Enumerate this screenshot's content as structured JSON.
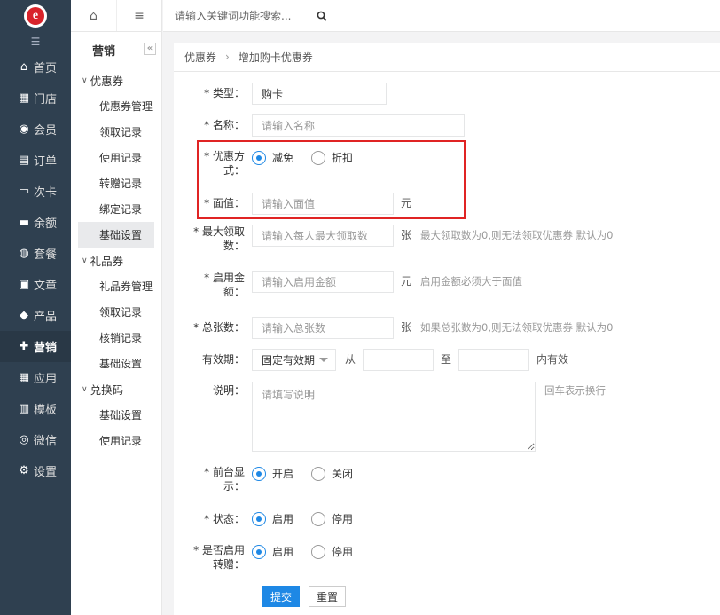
{
  "sidebar": {
    "logo_letter": "e",
    "items": [
      {
        "label": "首页",
        "icon": "home-icon",
        "glyph": "⌂"
      },
      {
        "label": "门店",
        "icon": "store-icon",
        "glyph": "▦"
      },
      {
        "label": "会员",
        "icon": "member-icon",
        "glyph": "◉"
      },
      {
        "label": "订单",
        "icon": "order-icon",
        "glyph": "▤"
      },
      {
        "label": "次卡",
        "icon": "card-icon",
        "glyph": "▭"
      },
      {
        "label": "余额",
        "icon": "balance-icon",
        "glyph": "▬"
      },
      {
        "label": "套餐",
        "icon": "package-icon",
        "glyph": "◍"
      },
      {
        "label": "文章",
        "icon": "article-icon",
        "glyph": "▣"
      },
      {
        "label": "产品",
        "icon": "product-icon",
        "glyph": "◆"
      },
      {
        "label": "营销",
        "icon": "marketing-icon",
        "glyph": "✚"
      },
      {
        "label": "应用",
        "icon": "apps-icon",
        "glyph": "▦"
      },
      {
        "label": "模板",
        "icon": "template-icon",
        "glyph": "▥"
      },
      {
        "label": "微信",
        "icon": "wechat-icon",
        "glyph": "◎"
      },
      {
        "label": "设置",
        "icon": "settings-icon",
        "glyph": "⚙"
      }
    ],
    "active_index": 9
  },
  "submenu": {
    "title": "营销",
    "groups": [
      {
        "label": "优惠券",
        "items": [
          "优惠券管理",
          "领取记录",
          "使用记录",
          "转赠记录",
          "绑定记录",
          "基础设置"
        ]
      },
      {
        "label": "礼品券",
        "items": [
          "礼品券管理",
          "领取记录",
          "核销记录",
          "基础设置"
        ]
      },
      {
        "label": "兑换码",
        "items": [
          "基础设置",
          "使用记录"
        ]
      }
    ]
  },
  "topbar": {
    "search_placeholder": "请输入关键词功能搜索..."
  },
  "breadcrumb": {
    "parent": "优惠券",
    "current": "增加购卡优惠券"
  },
  "form": {
    "type": {
      "label": "* 类型：",
      "value": "购卡"
    },
    "name": {
      "label": "* 名称：",
      "placeholder": "请输入名称"
    },
    "method": {
      "label_line1": "* 优惠方",
      "label_line2": "式：",
      "options": [
        "减免",
        "折扣"
      ],
      "selected": 0
    },
    "face_value": {
      "label": "* 面值：",
      "placeholder": "请输入面值",
      "unit": "元"
    },
    "max_claim": {
      "label_line1": "* 最大领取",
      "label_line2": "数：",
      "placeholder": "请输入每人最大领取数",
      "unit": "张",
      "hint": "最大领取数为0,则无法领取优惠券 默认为0"
    },
    "min_amount": {
      "label_line1": "* 启用金",
      "label_line2": "额：",
      "placeholder": "请输入启用金额",
      "unit": "元",
      "hint": "启用金额必须大于面值"
    },
    "total": {
      "label": "* 总张数：",
      "placeholder": "请输入总张数",
      "unit": "张",
      "hint": "如果总张数为0,则无法领取优惠券 默认为0"
    },
    "validity": {
      "label": "有效期：",
      "select_value": "固定有效期",
      "from": "从",
      "to": "至",
      "suffix": "内有效"
    },
    "desc": {
      "label": "说明：",
      "placeholder": "请填写说明",
      "hint": "回车表示换行"
    },
    "front_display": {
      "label_line1": "* 前台显",
      "label_line2": "示：",
      "options": [
        "开启",
        "关闭"
      ],
      "selected": 0
    },
    "status": {
      "label": "* 状态：",
      "options": [
        "启用",
        "停用"
      ],
      "selected": 0
    },
    "transfer": {
      "label_line1": "* 是否启用",
      "label_line2": "转赠：",
      "options": [
        "启用",
        "停用"
      ],
      "selected": 0
    },
    "submit_label": "提交",
    "reset_label": "重置"
  },
  "colors": {
    "sidebar_bg": "#2f4050",
    "accent": "#1e88e5",
    "highlight": "#e02424"
  }
}
